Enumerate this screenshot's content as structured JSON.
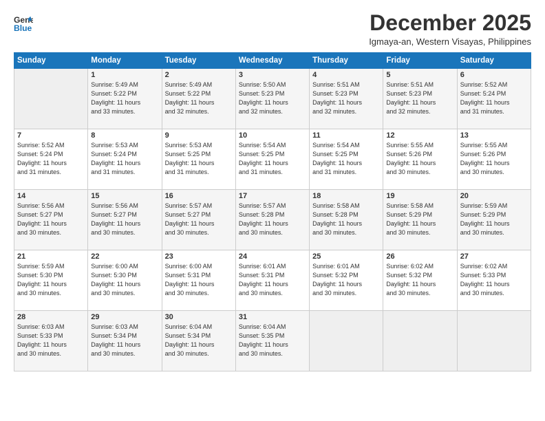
{
  "logo": {
    "line1": "General",
    "line2": "Blue"
  },
  "title": "December 2025",
  "subtitle": "Igmaya-an, Western Visayas, Philippines",
  "days_of_week": [
    "Sunday",
    "Monday",
    "Tuesday",
    "Wednesday",
    "Thursday",
    "Friday",
    "Saturday"
  ],
  "weeks": [
    [
      {
        "day": "",
        "info": ""
      },
      {
        "day": "1",
        "info": "Sunrise: 5:49 AM\nSunset: 5:22 PM\nDaylight: 11 hours\nand 33 minutes."
      },
      {
        "day": "2",
        "info": "Sunrise: 5:49 AM\nSunset: 5:22 PM\nDaylight: 11 hours\nand 32 minutes."
      },
      {
        "day": "3",
        "info": "Sunrise: 5:50 AM\nSunset: 5:23 PM\nDaylight: 11 hours\nand 32 minutes."
      },
      {
        "day": "4",
        "info": "Sunrise: 5:51 AM\nSunset: 5:23 PM\nDaylight: 11 hours\nand 32 minutes."
      },
      {
        "day": "5",
        "info": "Sunrise: 5:51 AM\nSunset: 5:23 PM\nDaylight: 11 hours\nand 32 minutes."
      },
      {
        "day": "6",
        "info": "Sunrise: 5:52 AM\nSunset: 5:24 PM\nDaylight: 11 hours\nand 31 minutes."
      }
    ],
    [
      {
        "day": "7",
        "info": "Sunrise: 5:52 AM\nSunset: 5:24 PM\nDaylight: 11 hours\nand 31 minutes."
      },
      {
        "day": "8",
        "info": "Sunrise: 5:53 AM\nSunset: 5:24 PM\nDaylight: 11 hours\nand 31 minutes."
      },
      {
        "day": "9",
        "info": "Sunrise: 5:53 AM\nSunset: 5:25 PM\nDaylight: 11 hours\nand 31 minutes."
      },
      {
        "day": "10",
        "info": "Sunrise: 5:54 AM\nSunset: 5:25 PM\nDaylight: 11 hours\nand 31 minutes."
      },
      {
        "day": "11",
        "info": "Sunrise: 5:54 AM\nSunset: 5:25 PM\nDaylight: 11 hours\nand 31 minutes."
      },
      {
        "day": "12",
        "info": "Sunrise: 5:55 AM\nSunset: 5:26 PM\nDaylight: 11 hours\nand 30 minutes."
      },
      {
        "day": "13",
        "info": "Sunrise: 5:55 AM\nSunset: 5:26 PM\nDaylight: 11 hours\nand 30 minutes."
      }
    ],
    [
      {
        "day": "14",
        "info": "Sunrise: 5:56 AM\nSunset: 5:27 PM\nDaylight: 11 hours\nand 30 minutes."
      },
      {
        "day": "15",
        "info": "Sunrise: 5:56 AM\nSunset: 5:27 PM\nDaylight: 11 hours\nand 30 minutes."
      },
      {
        "day": "16",
        "info": "Sunrise: 5:57 AM\nSunset: 5:27 PM\nDaylight: 11 hours\nand 30 minutes."
      },
      {
        "day": "17",
        "info": "Sunrise: 5:57 AM\nSunset: 5:28 PM\nDaylight: 11 hours\nand 30 minutes."
      },
      {
        "day": "18",
        "info": "Sunrise: 5:58 AM\nSunset: 5:28 PM\nDaylight: 11 hours\nand 30 minutes."
      },
      {
        "day": "19",
        "info": "Sunrise: 5:58 AM\nSunset: 5:29 PM\nDaylight: 11 hours\nand 30 minutes."
      },
      {
        "day": "20",
        "info": "Sunrise: 5:59 AM\nSunset: 5:29 PM\nDaylight: 11 hours\nand 30 minutes."
      }
    ],
    [
      {
        "day": "21",
        "info": "Sunrise: 5:59 AM\nSunset: 5:30 PM\nDaylight: 11 hours\nand 30 minutes."
      },
      {
        "day": "22",
        "info": "Sunrise: 6:00 AM\nSunset: 5:30 PM\nDaylight: 11 hours\nand 30 minutes."
      },
      {
        "day": "23",
        "info": "Sunrise: 6:00 AM\nSunset: 5:31 PM\nDaylight: 11 hours\nand 30 minutes."
      },
      {
        "day": "24",
        "info": "Sunrise: 6:01 AM\nSunset: 5:31 PM\nDaylight: 11 hours\nand 30 minutes."
      },
      {
        "day": "25",
        "info": "Sunrise: 6:01 AM\nSunset: 5:32 PM\nDaylight: 11 hours\nand 30 minutes."
      },
      {
        "day": "26",
        "info": "Sunrise: 6:02 AM\nSunset: 5:32 PM\nDaylight: 11 hours\nand 30 minutes."
      },
      {
        "day": "27",
        "info": "Sunrise: 6:02 AM\nSunset: 5:33 PM\nDaylight: 11 hours\nand 30 minutes."
      }
    ],
    [
      {
        "day": "28",
        "info": "Sunrise: 6:03 AM\nSunset: 5:33 PM\nDaylight: 11 hours\nand 30 minutes."
      },
      {
        "day": "29",
        "info": "Sunrise: 6:03 AM\nSunset: 5:34 PM\nDaylight: 11 hours\nand 30 minutes."
      },
      {
        "day": "30",
        "info": "Sunrise: 6:04 AM\nSunset: 5:34 PM\nDaylight: 11 hours\nand 30 minutes."
      },
      {
        "day": "31",
        "info": "Sunrise: 6:04 AM\nSunset: 5:35 PM\nDaylight: 11 hours\nand 30 minutes."
      },
      {
        "day": "",
        "info": ""
      },
      {
        "day": "",
        "info": ""
      },
      {
        "day": "",
        "info": ""
      }
    ]
  ],
  "colors": {
    "header_bg": "#1a75bb",
    "header_text": "#ffffff",
    "border": "#cccccc",
    "text": "#333333",
    "shade_bg": "#f5f5f5"
  }
}
